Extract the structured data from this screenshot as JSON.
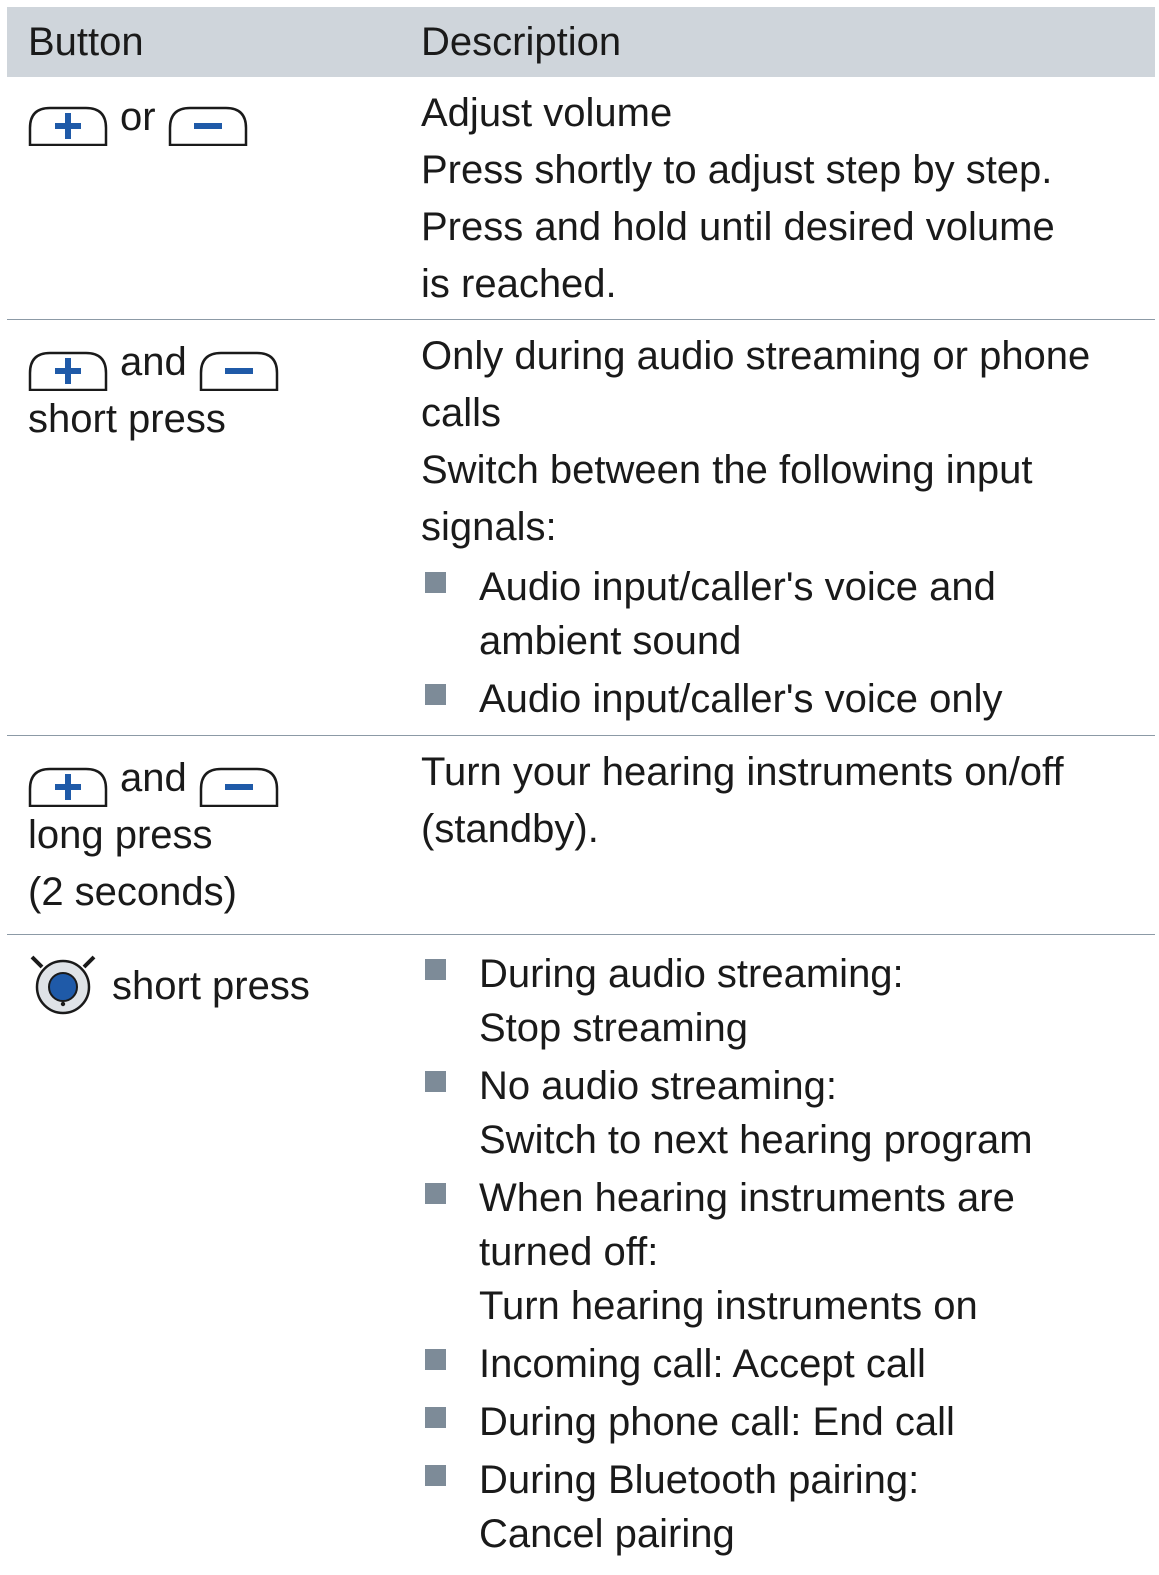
{
  "header": {
    "button_label": "Button",
    "description_label": "Description"
  },
  "rows": [
    {
      "button": {
        "connector": "or"
      },
      "description": {
        "lines": [
          "Adjust volume",
          "Press shortly to adjust step by step.",
          "Press and hold until desired volume",
          "is reached."
        ]
      }
    },
    {
      "button": {
        "connector": "and",
        "caption_lines": [
          "short press"
        ]
      },
      "description": {
        "lines": [
          "Only during audio streaming or phone",
          "calls",
          "Switch between the following input",
          "signals:"
        ],
        "bullets": [
          [
            "Audio input/caller's voice and",
            "ambient sound"
          ],
          [
            "Audio input/caller's voice only"
          ]
        ]
      }
    },
    {
      "button": {
        "connector": "and",
        "caption_lines": [
          "long press",
          "(2 seconds)"
        ]
      },
      "description": {
        "lines": [
          "Turn your hearing instruments on/off",
          "(standby)."
        ]
      }
    },
    {
      "button": {
        "caption": "short press"
      },
      "description": {
        "bullets": [
          [
            "During audio streaming:",
            "Stop streaming"
          ],
          [
            "No audio streaming:",
            "Switch to next hearing program"
          ],
          [
            "When hearing instruments are",
            "turned off:",
            "Turn hearing instruments on"
          ],
          [
            "Incoming call: Accept call"
          ],
          [
            "During phone call: End call"
          ],
          [
            "During Bluetooth pairing:",
            "Cancel pairing"
          ]
        ]
      }
    }
  ],
  "icons": {
    "plus_button": "plus-button-icon",
    "minus_button": "minus-button-icon",
    "program_button": "program-button-icon"
  },
  "colors": {
    "header_bg": "#cfd5db",
    "icon_blue": "#1f5aa8",
    "bullet": "#7d8b98",
    "divider": "#8c9aa6"
  }
}
